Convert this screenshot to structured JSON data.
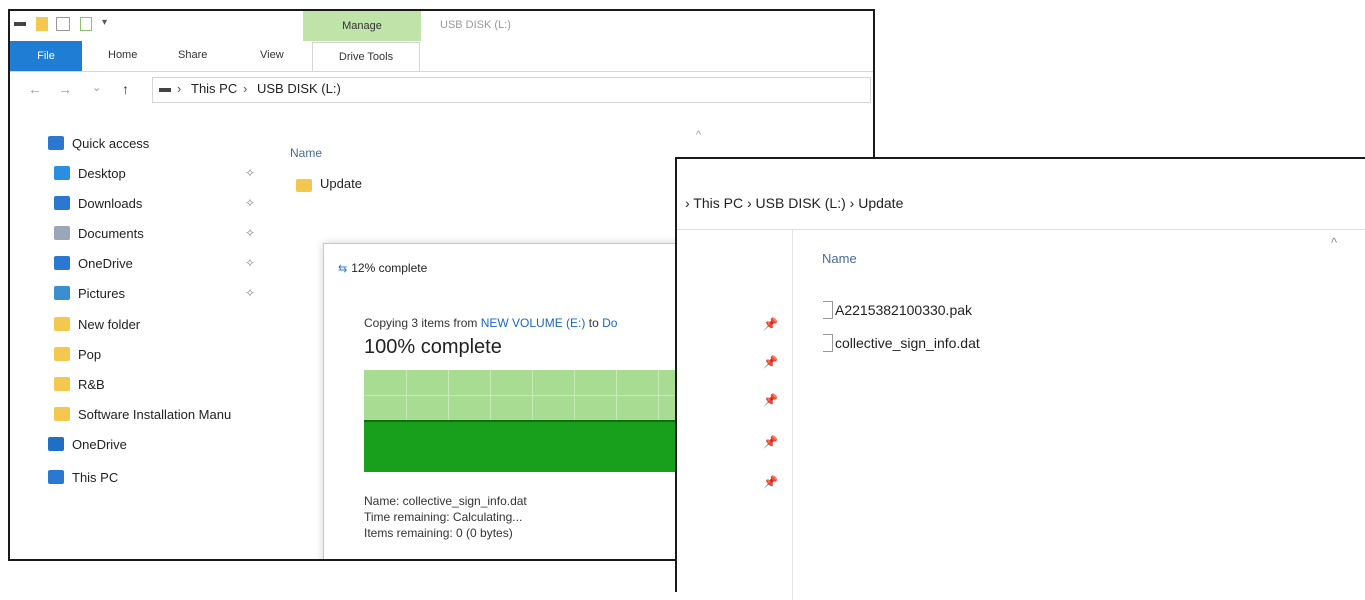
{
  "window1": {
    "quick_access_glyph": "▾",
    "manage_tab": "Manage",
    "window_title": "USB DISK (L:)",
    "ribbon": {
      "file": "File",
      "home": "Home",
      "share": "Share",
      "view": "View",
      "drive_tools": "Drive Tools"
    },
    "address": {
      "this_pc": "This PC",
      "drive": "USB DISK (L:)",
      "sep": "›"
    },
    "nav": [
      {
        "label": "Quick access",
        "icon": "star-icon",
        "color": "#2b78d0",
        "pinned": false
      },
      {
        "label": "Desktop",
        "icon": "desktop-icon",
        "color": "#2b8fe0",
        "pinned": true
      },
      {
        "label": "Downloads",
        "icon": "download-icon",
        "color": "#2b78d0",
        "pinned": true
      },
      {
        "label": "Documents",
        "icon": "document-icon",
        "color": "#9aa7b8",
        "pinned": true
      },
      {
        "label": "OneDrive",
        "icon": "cloud-icon",
        "color": "#2b78d0",
        "pinned": true
      },
      {
        "label": "Pictures",
        "icon": "picture-icon",
        "color": "#3a8fd0",
        "pinned": true
      },
      {
        "label": "New folder",
        "icon": "folder-icon",
        "color": "#f4c84e",
        "pinned": false
      },
      {
        "label": "Pop",
        "icon": "folder-icon",
        "color": "#f4c84e",
        "pinned": false
      },
      {
        "label": "R&B",
        "icon": "folder-icon",
        "color": "#f4c84e",
        "pinned": false
      },
      {
        "label": "Software Installation Manu",
        "icon": "folder-icon",
        "color": "#f4c84e",
        "pinned": false
      },
      {
        "label": "OneDrive",
        "icon": "cloud-icon",
        "color": "#1f6fc5",
        "pinned": false
      },
      {
        "label": "This PC",
        "icon": "pc-icon",
        "color": "#2b78d0",
        "pinned": false
      }
    ],
    "column_name": "Name",
    "folder": "Update"
  },
  "copy_dialog": {
    "title": "12% complete",
    "copying_prefix": "Copying 3 items from",
    "source": "NEW VOLUME (E:)",
    "to": "to",
    "dest_fragment": "Do",
    "percent_text": "100% complete",
    "name_line": "Name: collective_sign_info.dat",
    "time_line": "Time remaining: Calculating...",
    "items_line": "Items remaining: 0 (0 bytes)",
    "progress": 1.0
  },
  "window2": {
    "address": "›  This PC  ›  USB DISK (L:)  ›  Update",
    "column_name": "Name",
    "files": [
      "A2215382100330.pak",
      "collective_sign_info.dat"
    ]
  },
  "colors": {
    "accent": "#1f7ed3",
    "manage": "#bfe3a9",
    "progress_fill": "#18a01d",
    "progress_bg": "#a9dc93"
  }
}
